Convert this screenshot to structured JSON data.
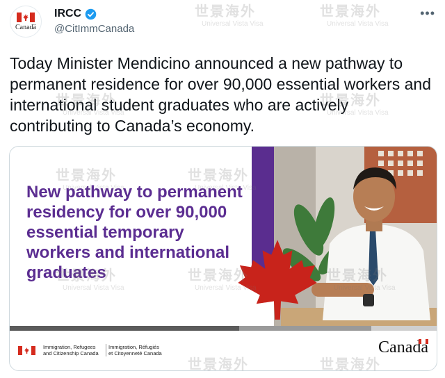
{
  "account": {
    "display_name": "IRCC",
    "handle": "@CitImmCanada",
    "avatar_wordmark": "Canadä",
    "verified_icon": "verified-badge-icon"
  },
  "tweet": {
    "text": "Today Minister Mendicino announced a new pathway to permanent residence for over 90,000 essential workers and international student graduates who are actively contributing to Canada’s economy."
  },
  "card": {
    "headline": "New pathway to permanent residency for over 90,000 essential temporary workers and international graduates",
    "department_en": "Immigration, Refugees\nand Citizenship Canada",
    "department_fr": "Immigration, Réfugiés\net Citoyenneté Canada",
    "wordmark": "Canada"
  },
  "watermark": {
    "cn": "世景海外",
    "en": "Universal Vista Visa"
  },
  "colors": {
    "purple": "#5b2d91",
    "canada_red": "#d52b1e",
    "verified_blue": "#1d9bf0"
  }
}
